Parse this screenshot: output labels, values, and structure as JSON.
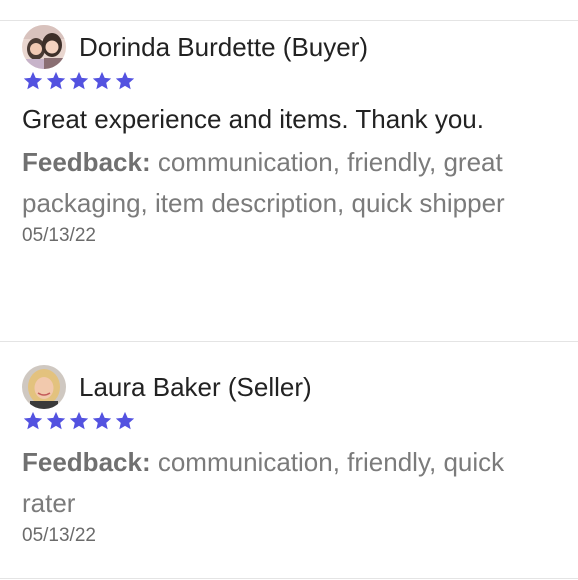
{
  "colors": {
    "star": "#5352e0",
    "divider": "#e4e4e4",
    "text_primary": "#222222",
    "text_secondary": "#7b7b7b"
  },
  "reviews": [
    {
      "reviewer": "Dorinda Burdette (Buyer)",
      "rating": 5,
      "comment": "Great experience and items. Thank you.",
      "feedback_label": "Feedback:",
      "feedback_items": "communication, friendly, great packaging, item description, quick shipper",
      "date": "05/13/22",
      "avatar_icon": "group-selfie-avatar"
    },
    {
      "reviewer": "Laura Baker (Seller)",
      "rating": 5,
      "comment": "",
      "feedback_label": "Feedback:",
      "feedback_items": "communication, friendly, quick rater",
      "date": "05/13/22",
      "avatar_icon": "blonde-woman-avatar"
    }
  ]
}
